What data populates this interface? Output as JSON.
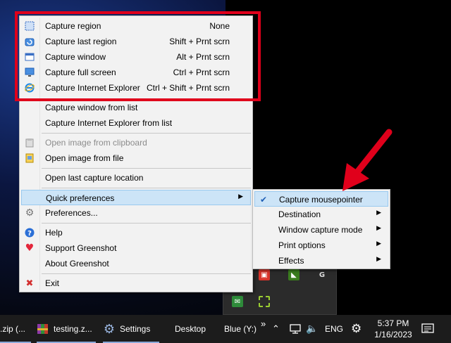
{
  "menu": {
    "items": [
      {
        "label": "Capture region",
        "shortcut": "None",
        "icon": "region-icon"
      },
      {
        "label": "Capture last region",
        "shortcut": "Shift + Prnt scrn",
        "icon": "last-region-icon"
      },
      {
        "label": "Capture window",
        "shortcut": "Alt + Prnt scrn",
        "icon": "window-icon"
      },
      {
        "label": "Capture full screen",
        "shortcut": "Ctrl + Prnt scrn",
        "icon": "monitor-icon"
      },
      {
        "label": "Capture Internet Explorer",
        "shortcut": "Ctrl + Shift + Prnt scrn",
        "icon": "ie-icon"
      },
      {
        "label": "Capture window from list"
      },
      {
        "label": "Capture Internet Explorer from list"
      },
      {
        "label": "Open image from clipboard",
        "icon": "clipboard-icon",
        "disabled": true
      },
      {
        "label": "Open image from file",
        "icon": "file-icon"
      },
      {
        "label": "Open last capture location"
      },
      {
        "label": "Quick preferences"
      },
      {
        "label": "Preferences...",
        "icon": "gear-icon"
      },
      {
        "label": "Help",
        "icon": "help-icon"
      },
      {
        "label": "Support Greenshot",
        "icon": "heart-icon"
      },
      {
        "label": "About Greenshot"
      },
      {
        "label": "Exit",
        "icon": "close-icon"
      }
    ]
  },
  "submenu": {
    "items": [
      {
        "label": "Capture mousepointer",
        "checked": true
      },
      {
        "label": "Destination"
      },
      {
        "label": "Window capture mode"
      },
      {
        "label": "Print options"
      },
      {
        "label": "Effects"
      }
    ]
  },
  "taskbar": {
    "zip_label": ".zip (...",
    "testing_label": "testing.z...",
    "settings_label": "Settings",
    "desktop_label": "Desktop",
    "blue_label": "Blue (Y:)",
    "more_glyph": "»",
    "lang": "ENG",
    "time": "5:37 PM",
    "date": "1/16/2023"
  },
  "colors": {
    "annotation_red": "#e0001b",
    "menu_bg": "#f2f2f2",
    "highlight": "#cce4f7",
    "taskbar_bg": "#1c1c1c"
  }
}
